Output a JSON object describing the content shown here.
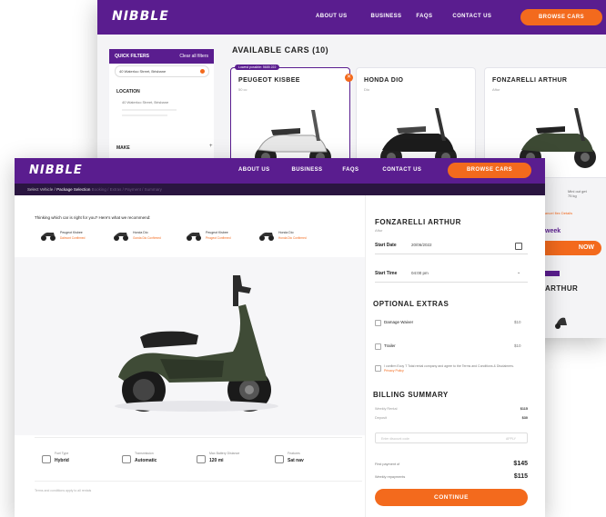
{
  "brand": {
    "logo": "NIBBLE",
    "accent": "#f36a1d",
    "primary": "#5a1d8f"
  },
  "back_window": {
    "nav": {
      "links": [
        "ABOUT US",
        "BUSINESS",
        "FAQS",
        "CONTACT US"
      ],
      "browse": "BROWSE CARS"
    },
    "filters": {
      "title": "QUICK FILTERS",
      "clear": "Clear all filters",
      "location_value": "40 Waterloo Street, Brisbane",
      "location_label": "LOCATION",
      "location_text": "40 Waterloo Street, Brisbane",
      "make_label": "MAKE"
    },
    "available_title": "AVAILABLE CARS (10)",
    "cards": [
      {
        "name": "PEUGEOT KISBEE",
        "sub": "50 cc",
        "tag": "Lowest possible: 5685 222"
      },
      {
        "name": "HONDA DIO",
        "sub": "Dio"
      },
      {
        "name": "FONZARELLI ARTHUR",
        "sub": "Aftur"
      }
    ],
    "right_small_1": "Mini out get\n75 kg",
    "right_small_2": "Cancel flex Details",
    "week": "week",
    "now_btn": "NOW",
    "card2_name": "ARTHUR"
  },
  "front_window": {
    "nav": {
      "links": [
        "ABOUT US",
        "BUSINESS",
        "FAQS",
        "CONTACT US"
      ],
      "browse": "BROWSE CARS"
    },
    "breadcrumb": {
      "step1": "Select Vehicle",
      "sep": "/",
      "current": "Package Selection",
      "rest": "Booking / Extras / Payment / Summary"
    },
    "think": "Thinking which car is right for you? Here's what we recommend:",
    "minis": [
      {
        "name": "Peugeot Kisbee",
        "sub": "Dalmont Confirmed"
      },
      {
        "name": "Honda Dio",
        "sub": "Gonda Dio Confirmed"
      },
      {
        "name": "Peugeot Kisbee",
        "sub": "Peugeot Confirmed"
      },
      {
        "name": "Honda Dio",
        "sub": "Honda Dio Confirmed"
      }
    ],
    "specs": [
      {
        "label": "Fuel Type",
        "value": "Hybrid"
      },
      {
        "label": "Transmission",
        "value": "Automatic"
      },
      {
        "label": "Max Battery Distance",
        "value": "120 mi"
      },
      {
        "label": "Features",
        "value": "Sat nav"
      }
    ],
    "terms_small": "Terms and conditions apply to all rentals",
    "booking": {
      "title": "FONZARELLI ARTHUR",
      "sub": "Aftur",
      "start_date_label": "Start Date",
      "start_date_value": "20/06/2022",
      "start_time_label": "Start Time",
      "start_time_value": "04:00 pm"
    },
    "extras": {
      "title": "OPTIONAL EXTRAS",
      "items": [
        {
          "name": "Damage Waiver",
          "price": "$10"
        },
        {
          "name": "Trailer",
          "price": "$10"
        }
      ],
      "consent": "I confirm Ecoy T Total rental company and agree to the Terms and Conditions & Disclaimers.",
      "consent_link": "Privacy Policy"
    },
    "billing": {
      "title": "BILLING SUMMARY",
      "rows": [
        {
          "label": "Weekly Rental",
          "amount": "$115"
        },
        {
          "label": "Deposit",
          "amount": "$30"
        }
      ],
      "promo_placeholder": "Enter discount code",
      "promo_apply": "APPLY",
      "first_payment_label": "First payment of",
      "first_payment_amount": "$145",
      "weekly_label": "Weekly repayments",
      "weekly_amount": "$115"
    },
    "continue": "CONTINUE"
  }
}
